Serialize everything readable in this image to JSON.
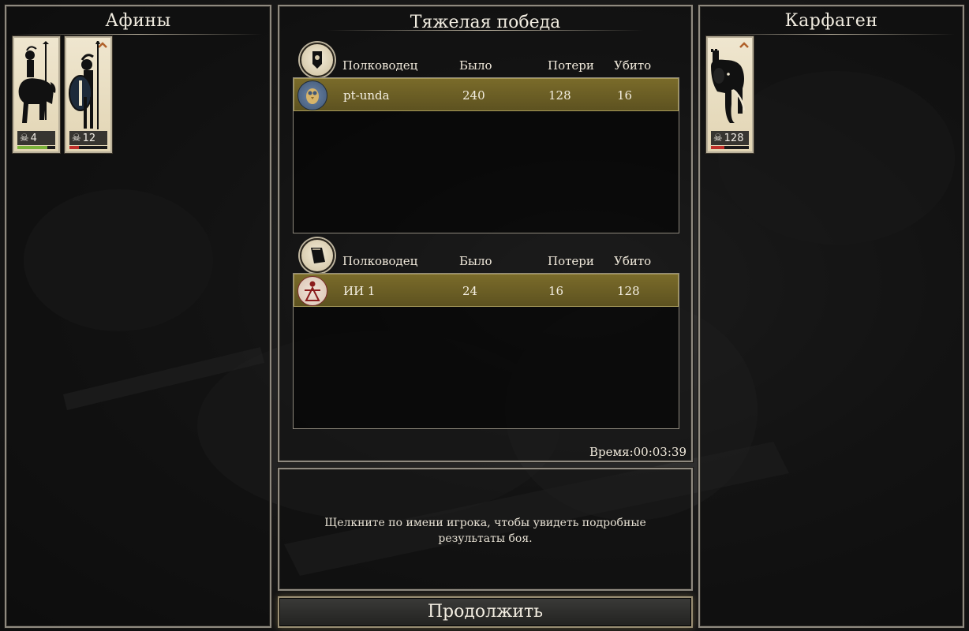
{
  "left_panel": {
    "title": "Афины",
    "units": [
      {
        "icon": "hoplite-cavalry-icon",
        "count": "4",
        "hp_fraction": 0.8,
        "hp_color": "#7bb33a"
      },
      {
        "icon": "hoplite-spearman-icon",
        "count": "12",
        "hp_fraction": 0.25,
        "hp_color": "#c0302a"
      }
    ]
  },
  "center_panel": {
    "title": "Тяжелая победа",
    "columns": {
      "commander": "Полководец",
      "was": "Было",
      "losses": "Потери",
      "killed": "Убито"
    },
    "side1": {
      "emblem": "banner-emblem-icon",
      "row": {
        "faction_icon": "owl-icon",
        "commander": "pt-unda",
        "was": "240",
        "losses": "128",
        "killed": "16"
      }
    },
    "side2": {
      "emblem": "flag-emblem-icon",
      "row": {
        "faction_icon": "tanit-icon",
        "commander": "ИИ 1",
        "was": "24",
        "losses": "16",
        "killed": "128"
      }
    },
    "time": "Время:00:03:39"
  },
  "info_box": {
    "text": "Щелкните по имени игрока, чтобы увидеть подробные результаты боя."
  },
  "continue_button": {
    "label": "Продолжить"
  },
  "right_panel": {
    "title": "Карфаген",
    "units": [
      {
        "icon": "war-elephant-icon",
        "count": "128",
        "hp_fraction": 0.35,
        "hp_color": "#c0302a"
      }
    ]
  },
  "colors": {
    "highlight_row": "#6b5e25",
    "panel_border": "#8f8a80",
    "accent_gold": "#b08a4a"
  }
}
